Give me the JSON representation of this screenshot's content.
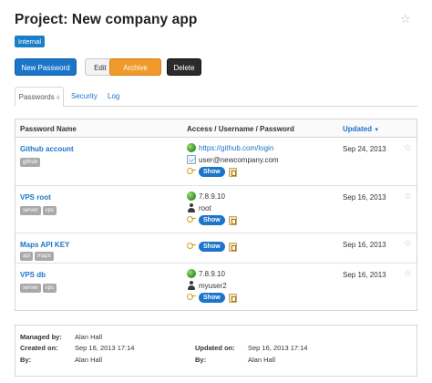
{
  "project": {
    "title": "Project: New company app",
    "tag": "Internal"
  },
  "toolbar": {
    "new_password": "New Password",
    "edit": "Edit",
    "archive": "Archive",
    "delete": "Delete"
  },
  "tabs": [
    {
      "label": "Passwords",
      "count": "4"
    },
    {
      "label": "Security"
    },
    {
      "label": "Log"
    }
  ],
  "table": {
    "headers": {
      "name": "Password Name",
      "access": "Access / Username / Password",
      "updated": "Updated"
    },
    "show_label": "Show",
    "rows": [
      {
        "name": "Github account",
        "tags": [
          "github"
        ],
        "url": "https://github.com/login",
        "username": "user@newcompany.com",
        "updated": "Sep 24, 2013"
      },
      {
        "name": "VPS root",
        "tags": [
          "server",
          "vps"
        ],
        "url": "7.8.9.10",
        "username": "root",
        "updated": "Sep 16, 2013"
      },
      {
        "name": "Maps API KEY",
        "tags": [
          "api",
          "maps"
        ],
        "updated": "Sep 16, 2013"
      },
      {
        "name": "VPS db",
        "tags": [
          "server",
          "vps"
        ],
        "url": "7.8.9.10",
        "username": "myuser2",
        "updated": "Sep 16, 2013"
      }
    ]
  },
  "meta": {
    "managed_by_label": "Managed by:",
    "managed_by": "Alan Hall",
    "created_on_label": "Created on:",
    "created_on": "Sep 16, 2013 17:14",
    "created_by_label": "By:",
    "created_by": "Alan Hall",
    "updated_on_label": "Updated on:",
    "updated_on": "Sep 16, 2013 17:14",
    "updated_by_label": "By:",
    "updated_by": "Alan Hall"
  },
  "colors": {
    "primary": "#1b75c9",
    "warning": "#ef9a2b",
    "dark": "#2b2b2b",
    "tag_gray": "#a9a9a9"
  },
  "icons": {
    "star": "star-icon",
    "globe": "globe-icon",
    "mail": "mail-icon",
    "user": "user-icon",
    "key": "key-icon",
    "copy": "copy-icon"
  }
}
